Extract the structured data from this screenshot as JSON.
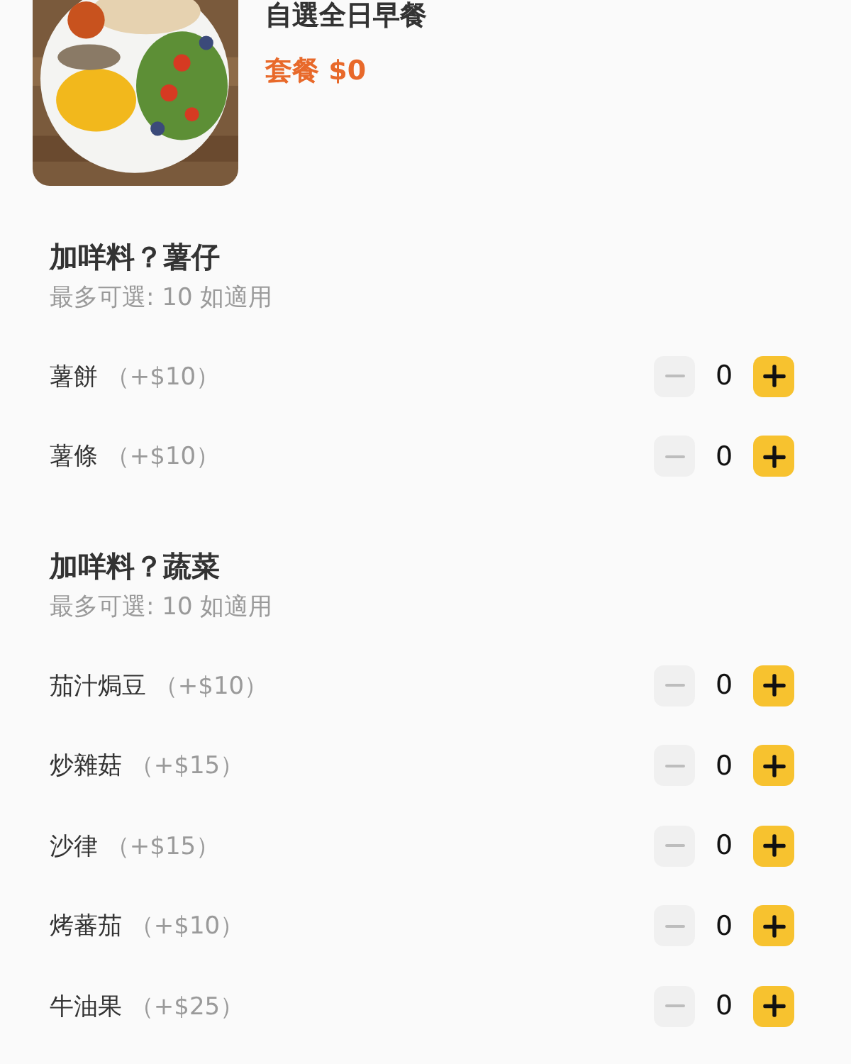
{
  "product": {
    "title": "自選全日早餐",
    "price": "套餐  $0"
  },
  "sections": [
    {
      "title": "加咩料？薯仔",
      "subtitle": "最多可選: 10  如適用",
      "items": [
        {
          "name": "薯餅",
          "price": "（+$10）",
          "count": "0",
          "minus_disabled": true
        },
        {
          "name": "薯條",
          "price": "（+$10）",
          "count": "0",
          "minus_disabled": true
        }
      ]
    },
    {
      "title": "加咩料？蔬菜",
      "subtitle": "最多可選: 10  如適用",
      "items": [
        {
          "name": "茄汁焗豆",
          "price": "（+$10）",
          "count": "0",
          "minus_disabled": true
        },
        {
          "name": "炒雜菇",
          "price": "（+$15）",
          "count": "0",
          "minus_disabled": true
        },
        {
          "name": "沙律",
          "price": "（+$15）",
          "count": "0",
          "minus_disabled": true
        },
        {
          "name": "烤蕃茄",
          "price": "（+$10）",
          "count": "0",
          "minus_disabled": true
        },
        {
          "name": "牛油果",
          "price": "（+$25）",
          "count": "0",
          "minus_disabled": true
        }
      ]
    }
  ]
}
